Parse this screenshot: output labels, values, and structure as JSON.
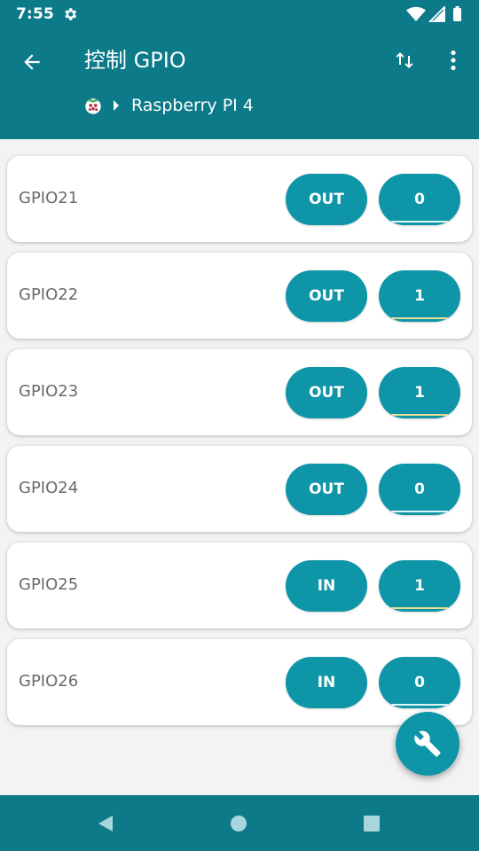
{
  "status_bar": {
    "time": "7:55",
    "icons": [
      "settings-icon",
      "wifi-icon",
      "signal-icon",
      "battery-icon"
    ]
  },
  "app_bar": {
    "title": "控制 GPIO",
    "breadcrumb": {
      "device_icon": "raspberry-pi-icon",
      "device_name": "Raspberry PI 4"
    },
    "actions": [
      "arrow-left-icon",
      "swap-vertical-icon",
      "more-vert-icon"
    ]
  },
  "gpio_pins": [
    {
      "name": "GPIO21",
      "mode": "OUT",
      "value": "0"
    },
    {
      "name": "GPIO22",
      "mode": "OUT",
      "value": "1"
    },
    {
      "name": "GPIO23",
      "mode": "OUT",
      "value": "1"
    },
    {
      "name": "GPIO24",
      "mode": "OUT",
      "value": "0"
    },
    {
      "name": "GPIO25",
      "mode": "IN",
      "value": "1"
    },
    {
      "name": "GPIO26",
      "mode": "IN",
      "value": "0"
    }
  ],
  "fab": {
    "icon": "wrench-icon"
  },
  "nav_bar": {
    "icons": [
      "nav-back-icon",
      "nav-home-icon",
      "nav-recents-icon"
    ]
  },
  "colors": {
    "primary": "#0c7a89",
    "accent": "#0e95a8",
    "background": "#f3f3f3",
    "card": "#ffffff",
    "on_indicator": "#e8dd94"
  }
}
